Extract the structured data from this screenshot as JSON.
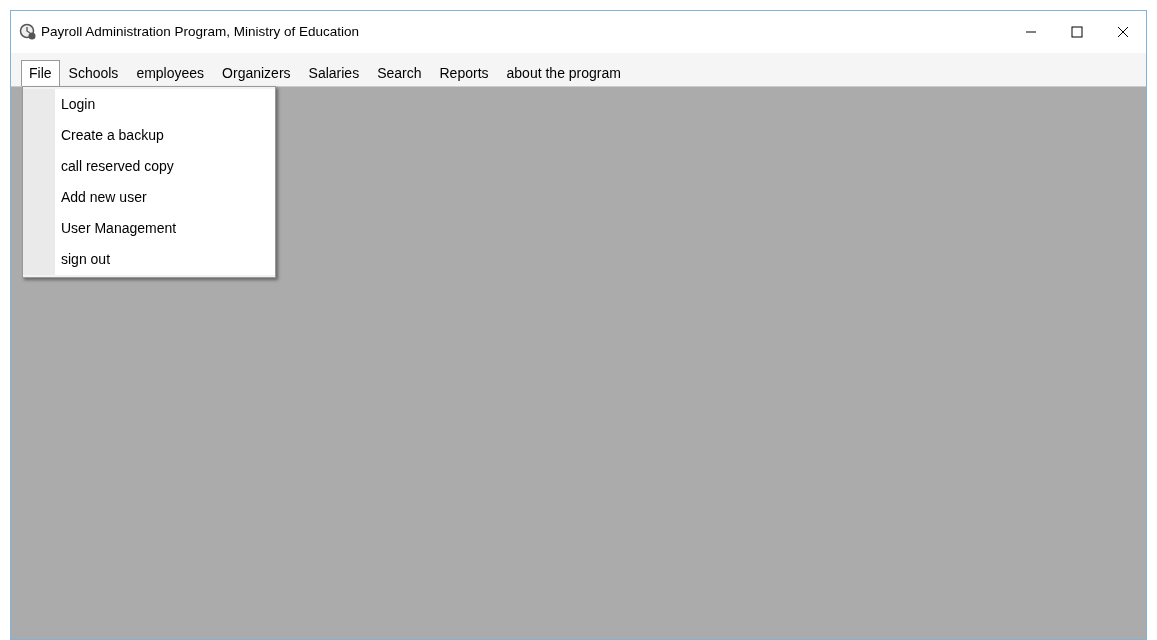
{
  "window": {
    "title": "Payroll Administration Program, Ministry of Education"
  },
  "menu_bar": [
    {
      "label": "File",
      "selected": true
    },
    {
      "label": "Schools",
      "selected": false
    },
    {
      "label": "employees",
      "selected": false
    },
    {
      "label": "Organizers",
      "selected": false
    },
    {
      "label": "Salaries",
      "selected": false
    },
    {
      "label": "Search",
      "selected": false
    },
    {
      "label": "Reports",
      "selected": false
    },
    {
      "label": "about the program",
      "selected": false
    }
  ],
  "open_menu": {
    "items": [
      "Login",
      "Create a backup",
      "call reserved copy",
      "Add new user",
      "User Management",
      "sign out"
    ]
  }
}
